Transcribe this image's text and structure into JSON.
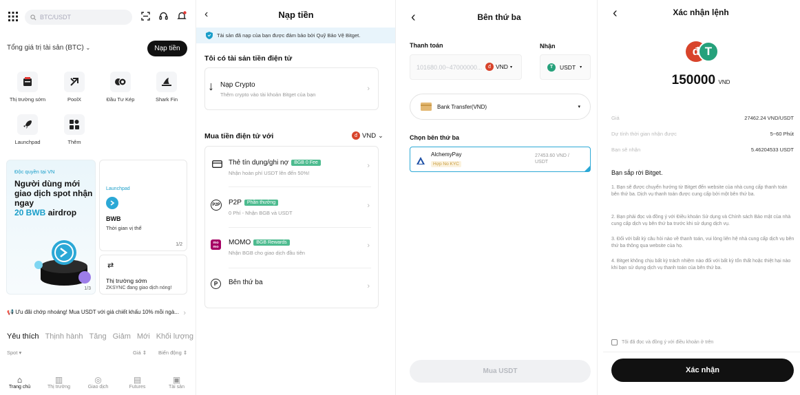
{
  "home": {
    "search_placeholder": "BTC/USDT",
    "total_label": "Tổng giá trị tài sản (BTC)",
    "deposit_button": "Nạp tiền",
    "features": [
      {
        "label": "Thị trường sớm",
        "icon": "early-market-icon"
      },
      {
        "label": "PoolX",
        "icon": "poolx-icon"
      },
      {
        "label": "Đầu Tư Kép",
        "icon": "dual-invest-icon"
      },
      {
        "label": "Shark Fin",
        "icon": "shark-fin-icon"
      },
      {
        "label": "Launchpad",
        "icon": "rocket-icon"
      },
      {
        "label": "Thêm",
        "icon": "more-grid-icon"
      }
    ],
    "promo": {
      "tag": "Độc quyền tại VN",
      "headline": "Người dùng mới giao dịch spot nhận ngay",
      "highlight": "20 BWB",
      "suffix": "airdrop",
      "page": "1/3"
    },
    "launch_card": {
      "tag": "Launchpad",
      "title": "BWB",
      "sub": "Thời gian vị thế",
      "page": "1/2"
    },
    "market_card": {
      "title": "Thị trường sớm",
      "sub": "ZKSYNC đang giao dịch nóng!"
    },
    "notice": "Ưu đãi chớp nhoáng! Mua USDT với giá chiết khấu 10% mỗi ngà...",
    "tabs": [
      "Yêu thích",
      "Thịnh hành",
      "Tăng",
      "Giảm",
      "Mới",
      "Khối lượng"
    ],
    "table_headers": {
      "market": "Spot",
      "price": "Giá",
      "change": "Biến động"
    },
    "nav": [
      {
        "label": "Trang chủ",
        "icon": "home-icon",
        "active": true
      },
      {
        "label": "Thị trường",
        "icon": "market-chart-icon",
        "active": false
      },
      {
        "label": "Giao dịch",
        "icon": "trade-icon",
        "active": false
      },
      {
        "label": "Futures",
        "icon": "futures-icon",
        "active": false
      },
      {
        "label": "Tài sản",
        "icon": "wallet-icon",
        "active": false
      }
    ]
  },
  "deposit": {
    "title": "Nạp tiền",
    "banner": "Tài sản đã nạp của bạn được đảm bảo bởi Quỹ Bảo Vệ Bitget.",
    "have_crypto_title": "Tôi có tài sản tiền điện tử",
    "crypto_row": {
      "title": "Nạp Crypto",
      "sub": "Thêm crypto vào tài khoản Bitget của bạn"
    },
    "buy_title": "Mua tiền điện tử với",
    "currency": "VND",
    "methods": [
      {
        "title": "Thẻ tín dụng/ghi nợ",
        "badge": "BGB 0 Fee",
        "sub": "Nhận hoàn phí USDT lên đến 50%!",
        "icon": "credit-card-icon"
      },
      {
        "title": "P2P",
        "badge": "Phần thưởng",
        "sub": "0 Phí - Nhận BGB và USDT",
        "icon": "p2p-icon"
      },
      {
        "title": "MOMO",
        "badge": "BGB Rewards",
        "sub": "Nhận BGB cho giao dịch đầu tiên",
        "icon": "momo-icon"
      },
      {
        "title": "Bên thứ ba",
        "badge": "",
        "sub": "",
        "icon": "third-party-icon"
      }
    ]
  },
  "third_party": {
    "title": "Bên thứ ba",
    "pay_label": "Thanh toán",
    "receive_label": "Nhận",
    "pay_placeholder": "101680.00~47000000...",
    "pay_currency": "VND",
    "receive_currency": "USDT",
    "method": "Bank Transfer(VND)",
    "choose_label": "Chọn bên thứ ba",
    "provider": {
      "name": "AlchemyPay",
      "tag": "Hợp No KYC",
      "rate": "27453.60 VND / USDT"
    },
    "buy_button": "Mua USDT"
  },
  "confirm": {
    "title": "Xác nhận lệnh",
    "amount": "150000",
    "amount_unit": "VND",
    "rows": [
      {
        "label": "Giá",
        "value": "27462.24 VND/USDT"
      },
      {
        "label": "Dự tính thời gian nhận được",
        "value": "5~60 Phút"
      },
      {
        "label": "Bạn sẽ nhận",
        "value": "5.46204533 USDT"
      }
    ],
    "leaving_title": "Bạn sắp rời Bitget.",
    "terms": [
      "1. Bạn sẽ được chuyển hướng từ Bitget đến website của nhà cung cấp thanh toán bên thứ ba. Dịch vụ thanh toán được cung cấp bởi một bên thứ ba.",
      "2. Bạn phải đọc và đồng ý với Điều khoản Sử dụng và Chính sách Bảo mật của nhà cung cấp dịch vụ bên thứ ba trước khi sử dụng dịch vụ.",
      "3. Đối với bất kỳ câu hỏi nào về thanh toán, vui lòng liên hệ nhà cung cấp dịch vụ bên thứ ba thông qua website của họ.",
      "4. Bitget không chịu bất kỳ trách nhiệm nào đối với bất kỳ tổn thất hoặc thiệt hại nào khi bạn sử dụng dịch vụ thanh toán của bên thứ ba."
    ],
    "agree_label": "Tôi đã đọc và đồng ý với điều khoản ở trên",
    "confirm_button": "Xác nhận"
  },
  "colors": {
    "accent_green": "#4dbb8f",
    "primary_dark": "#111111",
    "vnd_red": "#d8442b",
    "usdt_green": "#26a17b",
    "highlight_blue": "#1a9ec9"
  }
}
